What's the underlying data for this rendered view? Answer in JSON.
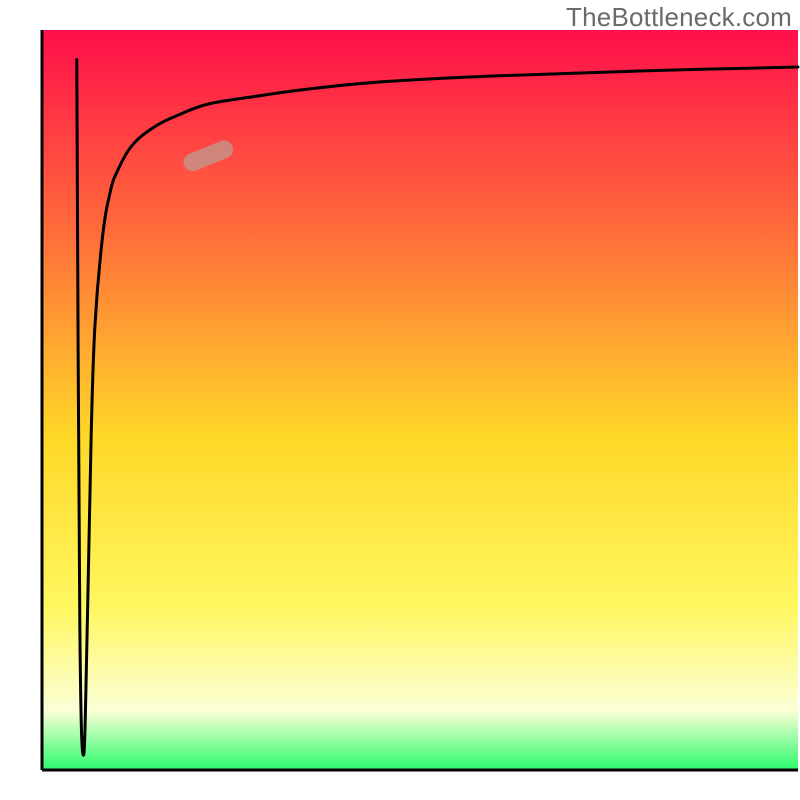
{
  "attribution": "TheBottleneck.com",
  "colors": {
    "gradient_top": "#ff0f4b",
    "gradient_mid_upper": "#ff6f3a",
    "gradient_mid": "#ffd828",
    "gradient_mid_lower": "#fff760",
    "gradient_lower": "#fbffd7",
    "gradient_bottom": "#2bfb6d",
    "axis": "#000000",
    "curve": "#000000",
    "marker_fill": "#c79187",
    "marker_stroke": "#a16e66"
  },
  "chart_data": {
    "type": "line",
    "title": "",
    "xlabel": "",
    "ylabel": "",
    "xlim": [
      0,
      100
    ],
    "ylim": [
      0,
      100
    ],
    "series": [
      {
        "name": "dip-curve",
        "x": [
          4.6,
          5.0,
          5.5,
          6.0,
          6.5,
          7.0,
          8.0,
          9.0,
          10.0,
          12.0,
          15.0,
          18.0,
          22.0,
          28.0,
          35.0,
          45.0,
          60.0,
          80.0,
          100.0
        ],
        "values": [
          96.0,
          20.0,
          2.0,
          20.0,
          45.0,
          60.0,
          72.0,
          78.0,
          81.0,
          84.5,
          87.0,
          88.5,
          90.0,
          91.0,
          92.0,
          93.0,
          93.8,
          94.5,
          95.0
        ]
      }
    ],
    "marker": {
      "series": "dip-curve",
      "x": 22.0,
      "y": 83.0,
      "angle_deg": 22
    },
    "grid": false,
    "legend": false
  }
}
